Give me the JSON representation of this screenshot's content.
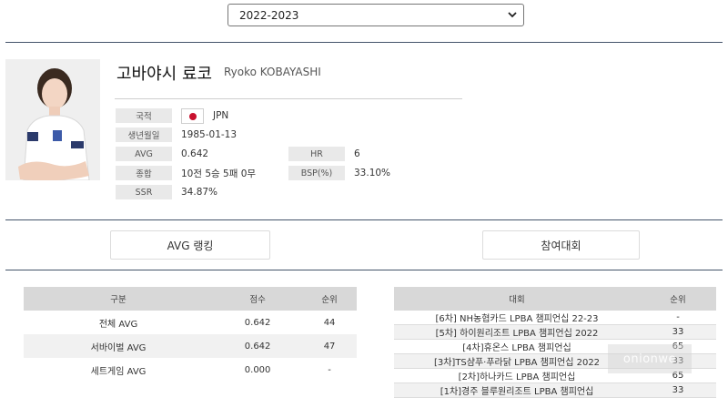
{
  "season_select": {
    "value": "2022-2023"
  },
  "player": {
    "name_ko": "고바야시 료코",
    "name_en": "Ryoko KOBAYASHI"
  },
  "info": {
    "nationality_label": "국적",
    "nationality_value": "JPN",
    "birth_label": "생년월일",
    "birth_value": "1985-01-13",
    "avg_label": "AVG",
    "avg_value": "0.642",
    "hr_label": "HR",
    "hr_value": "6",
    "total_label": "종합",
    "total_value": "10전 5승 5패 0무",
    "bsp_label": "BSP(%)",
    "bsp_value": "33.10%",
    "ssr_label": "SSR",
    "ssr_value": "34.87%"
  },
  "tabs": {
    "avg_ranking": "AVG 랭킹",
    "tournaments": "참여대회"
  },
  "avg_table": {
    "headers": [
      "구분",
      "점수",
      "순위"
    ],
    "rows": [
      [
        "전체 AVG",
        "0.642",
        "44"
      ],
      [
        "서바이벌 AVG",
        "0.642",
        "47"
      ],
      [
        "세트게임 AVG",
        "0.000",
        "-"
      ]
    ]
  },
  "tournament_table": {
    "headers": [
      "대회",
      "순위"
    ],
    "rows": [
      [
        "[6차] NH농협카드 LPBA 챔피언십 22-23",
        "-"
      ],
      [
        "[5차] 하이원리조트 LPBA 챔피언십 2022",
        "33"
      ],
      [
        "[4차]휴온스 LPBA 챔피언십",
        "65"
      ],
      [
        "[3차]TS샴푸·푸라닭 LPBA 챔피언십 2022",
        "33"
      ],
      [
        "[2차]하나카드 LPBA 챔피언십",
        "65"
      ],
      [
        "[1차]경주 블루원리조트 LPBA 챔피언십",
        "33"
      ]
    ]
  },
  "watermark": "onionwe",
  "colors": {
    "divider": "#44546a",
    "flag_red": "#c8102e",
    "header_gray": "#d8d8d8"
  }
}
